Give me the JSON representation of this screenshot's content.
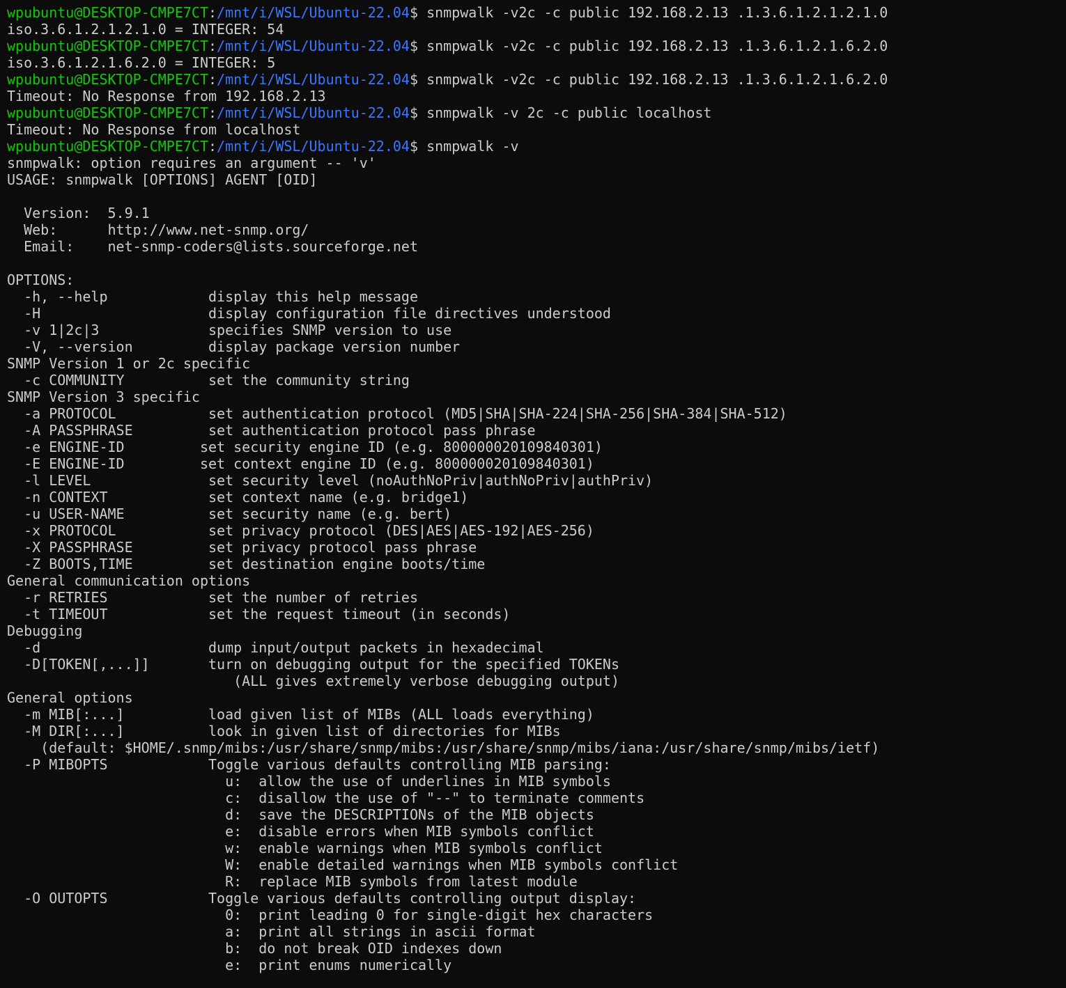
{
  "colors": {
    "background": "#0c0c0c",
    "text": "#cccccc",
    "user_host": "#16c60c",
    "path": "#3b78ff"
  },
  "prompt": {
    "user_host": "wpubuntu@DESKTOP-CMPE7CT",
    "path": "/mnt/i/WSL/Ubuntu-22.04",
    "symbol": "$ "
  },
  "lines": [
    {
      "type": "prompt",
      "command": "snmpwalk -v2c -c public 192.168.2.13 .1.3.6.1.2.1.2.1.0"
    },
    {
      "type": "output",
      "text": "iso.3.6.1.2.1.2.1.0 = INTEGER: 54"
    },
    {
      "type": "prompt",
      "command": "snmpwalk -v2c -c public 192.168.2.13 .1.3.6.1.2.1.6.2.0"
    },
    {
      "type": "output",
      "text": "iso.3.6.1.2.1.6.2.0 = INTEGER: 5"
    },
    {
      "type": "prompt",
      "command": "snmpwalk -v2c -c public 192.168.2.13 .1.3.6.1.2.1.6.2.0"
    },
    {
      "type": "output",
      "text": "Timeout: No Response from 192.168.2.13"
    },
    {
      "type": "prompt",
      "command": "snmpwalk -v 2c -c public localhost"
    },
    {
      "type": "output",
      "text": "Timeout: No Response from localhost"
    },
    {
      "type": "prompt",
      "command": "snmpwalk -v"
    },
    {
      "type": "output",
      "text": "snmpwalk: option requires an argument -- 'v'"
    },
    {
      "type": "output",
      "text": "USAGE: snmpwalk [OPTIONS] AGENT [OID]"
    },
    {
      "type": "output",
      "text": ""
    },
    {
      "type": "output",
      "text": "  Version:  5.9.1"
    },
    {
      "type": "output",
      "text": "  Web:      http://www.net-snmp.org/"
    },
    {
      "type": "output",
      "text": "  Email:    net-snmp-coders@lists.sourceforge.net"
    },
    {
      "type": "output",
      "text": ""
    },
    {
      "type": "output",
      "text": "OPTIONS:"
    },
    {
      "type": "output",
      "text": "  -h, --help            display this help message"
    },
    {
      "type": "output",
      "text": "  -H                    display configuration file directives understood"
    },
    {
      "type": "output",
      "text": "  -v 1|2c|3             specifies SNMP version to use"
    },
    {
      "type": "output",
      "text": "  -V, --version         display package version number"
    },
    {
      "type": "output",
      "text": "SNMP Version 1 or 2c specific"
    },
    {
      "type": "output",
      "text": "  -c COMMUNITY          set the community string"
    },
    {
      "type": "output",
      "text": "SNMP Version 3 specific"
    },
    {
      "type": "output",
      "text": "  -a PROTOCOL           set authentication protocol (MD5|SHA|SHA-224|SHA-256|SHA-384|SHA-512)"
    },
    {
      "type": "output",
      "text": "  -A PASSPHRASE         set authentication protocol pass phrase"
    },
    {
      "type": "output",
      "text": "  -e ENGINE-ID         set security engine ID (e.g. 800000020109840301)"
    },
    {
      "type": "output",
      "text": "  -E ENGINE-ID         set context engine ID (e.g. 800000020109840301)"
    },
    {
      "type": "output",
      "text": "  -l LEVEL              set security level (noAuthNoPriv|authNoPriv|authPriv)"
    },
    {
      "type": "output",
      "text": "  -n CONTEXT            set context name (e.g. bridge1)"
    },
    {
      "type": "output",
      "text": "  -u USER-NAME          set security name (e.g. bert)"
    },
    {
      "type": "output",
      "text": "  -x PROTOCOL           set privacy protocol (DES|AES|AES-192|AES-256)"
    },
    {
      "type": "output",
      "text": "  -X PASSPHRASE         set privacy protocol pass phrase"
    },
    {
      "type": "output",
      "text": "  -Z BOOTS,TIME         set destination engine boots/time"
    },
    {
      "type": "output",
      "text": "General communication options"
    },
    {
      "type": "output",
      "text": "  -r RETRIES            set the number of retries"
    },
    {
      "type": "output",
      "text": "  -t TIMEOUT            set the request timeout (in seconds)"
    },
    {
      "type": "output",
      "text": "Debugging"
    },
    {
      "type": "output",
      "text": "  -d                    dump input/output packets in hexadecimal"
    },
    {
      "type": "output",
      "text": "  -D[TOKEN[,...]]       turn on debugging output for the specified TOKENs"
    },
    {
      "type": "output",
      "text": "                           (ALL gives extremely verbose debugging output)"
    },
    {
      "type": "output",
      "text": "General options"
    },
    {
      "type": "output",
      "text": "  -m MIB[:...]          load given list of MIBs (ALL loads everything)"
    },
    {
      "type": "output",
      "text": "  -M DIR[:...]          look in given list of directories for MIBs"
    },
    {
      "type": "output",
      "text": "    (default: $HOME/.snmp/mibs:/usr/share/snmp/mibs:/usr/share/snmp/mibs/iana:/usr/share/snmp/mibs/ietf)"
    },
    {
      "type": "output",
      "text": "  -P MIBOPTS            Toggle various defaults controlling MIB parsing:"
    },
    {
      "type": "output",
      "text": "                          u:  allow the use of underlines in MIB symbols"
    },
    {
      "type": "output",
      "text": "                          c:  disallow the use of \"--\" to terminate comments"
    },
    {
      "type": "output",
      "text": "                          d:  save the DESCRIPTIONs of the MIB objects"
    },
    {
      "type": "output",
      "text": "                          e:  disable errors when MIB symbols conflict"
    },
    {
      "type": "output",
      "text": "                          w:  enable warnings when MIB symbols conflict"
    },
    {
      "type": "output",
      "text": "                          W:  enable detailed warnings when MIB symbols conflict"
    },
    {
      "type": "output",
      "text": "                          R:  replace MIB symbols from latest module"
    },
    {
      "type": "output",
      "text": "  -O OUTOPTS            Toggle various defaults controlling output display:"
    },
    {
      "type": "output",
      "text": "                          0:  print leading 0 for single-digit hex characters"
    },
    {
      "type": "output",
      "text": "                          a:  print all strings in ascii format"
    },
    {
      "type": "output",
      "text": "                          b:  do not break OID indexes down"
    },
    {
      "type": "output",
      "text": "                          e:  print enums numerically"
    }
  ]
}
